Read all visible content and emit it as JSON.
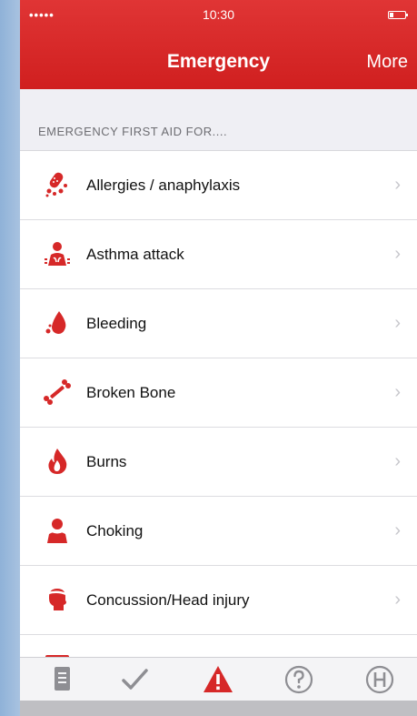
{
  "status_bar": {
    "signal": "•••••",
    "time": "10:30"
  },
  "navbar": {
    "title": "Emergency",
    "more_label": "More",
    "color": "#d62828"
  },
  "section": {
    "header": "EMERGENCY FIRST AID FOR...."
  },
  "items": [
    {
      "label": "Allergies / anaphylaxis",
      "icon": "allergies-icon"
    },
    {
      "label": "Asthma attack",
      "icon": "asthma-icon"
    },
    {
      "label": "Bleeding",
      "icon": "blood-drop-icon"
    },
    {
      "label": "Broken Bone",
      "icon": "bone-icon"
    },
    {
      "label": "Burns",
      "icon": "flame-icon"
    },
    {
      "label": "Choking",
      "icon": "choking-icon"
    },
    {
      "label": "Concussion/Head injury",
      "icon": "head-injury-icon"
    }
  ],
  "chevron": "›",
  "tabbar": {
    "tabs": [
      {
        "icon": "book-icon"
      },
      {
        "icon": "checkmark-icon"
      },
      {
        "icon": "warning-icon",
        "active": true
      },
      {
        "icon": "help-icon"
      },
      {
        "icon": "hospital-icon"
      }
    ]
  }
}
